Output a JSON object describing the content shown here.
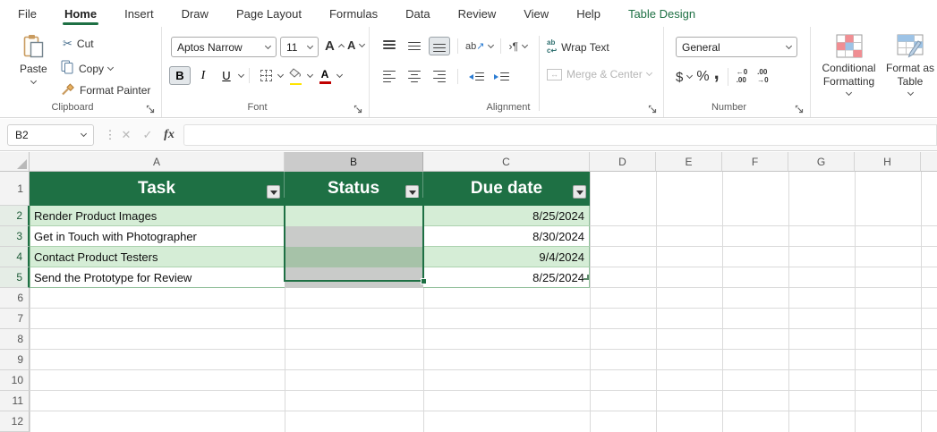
{
  "menu_tabs": [
    {
      "label": "File"
    },
    {
      "label": "Home"
    },
    {
      "label": "Insert"
    },
    {
      "label": "Draw"
    },
    {
      "label": "Page Layout"
    },
    {
      "label": "Formulas"
    },
    {
      "label": "Data"
    },
    {
      "label": "Review"
    },
    {
      "label": "View"
    },
    {
      "label": "Help"
    },
    {
      "label": "Table Design"
    }
  ],
  "ribbon": {
    "clipboard": {
      "label": "Clipboard",
      "paste": "Paste",
      "cut": "Cut",
      "copy": "Copy",
      "format_painter": "Format Painter"
    },
    "font": {
      "label": "Font",
      "font_name": "Aptos Narrow",
      "font_size": "11",
      "bold": "B",
      "italic": "I",
      "underline": "U",
      "grow": "A",
      "shrink": "A",
      "color_letter": "A"
    },
    "alignment": {
      "label": "Alignment",
      "orientation": "ab",
      "direction": "›¶",
      "wrap_text": "Wrap Text",
      "merge_center": "Merge & Center",
      "wrap_icon_top": "ab",
      "wrap_icon_bottom": "c↩"
    },
    "number": {
      "label": "Number",
      "format": "General",
      "currency": "$",
      "percent": "%",
      "comma": ",",
      "inc_top": "←0",
      "inc_bottom": ".00",
      "dec_top": ".00",
      "dec_bottom": "→0"
    },
    "styles": {
      "conditional_formatting": "Conditional Formatting",
      "format_as_table": "Format as Table"
    }
  },
  "formula_bar": {
    "name_box": "B2",
    "cancel": "✕",
    "enter": "✓",
    "fx": "fx",
    "value": ""
  },
  "grid": {
    "columns": [
      "A",
      "B",
      "C",
      "D",
      "E",
      "F",
      "G",
      "H"
    ],
    "rows": [
      "1",
      "2",
      "3",
      "4",
      "5",
      "6",
      "7",
      "8",
      "9",
      "10",
      "11",
      "12"
    ],
    "selected_column": "B",
    "selected_range": "B2:B5",
    "active_cell": "B2"
  },
  "table": {
    "headers": {
      "task": "Task",
      "status": "Status",
      "due": "Due date"
    },
    "rows": [
      {
        "task": "Render Product Images",
        "status": "",
        "due": "8/25/2024"
      },
      {
        "task": "Get in Touch with Photographer",
        "status": "",
        "due": "8/30/2024"
      },
      {
        "task": "Contact Product Testers",
        "status": "",
        "due": "9/4/2024"
      },
      {
        "task": "Send the Prototype for Review",
        "status": "",
        "due": "8/25/2024"
      }
    ]
  },
  "colors": {
    "excel_green": "#1E7044",
    "band_green": "#D5EDD6",
    "selection_gray": "#C9CBC9",
    "selection_green_gray": "#A6C2A8",
    "fill_yellow": "#FFE400",
    "font_red": "#C00000"
  }
}
